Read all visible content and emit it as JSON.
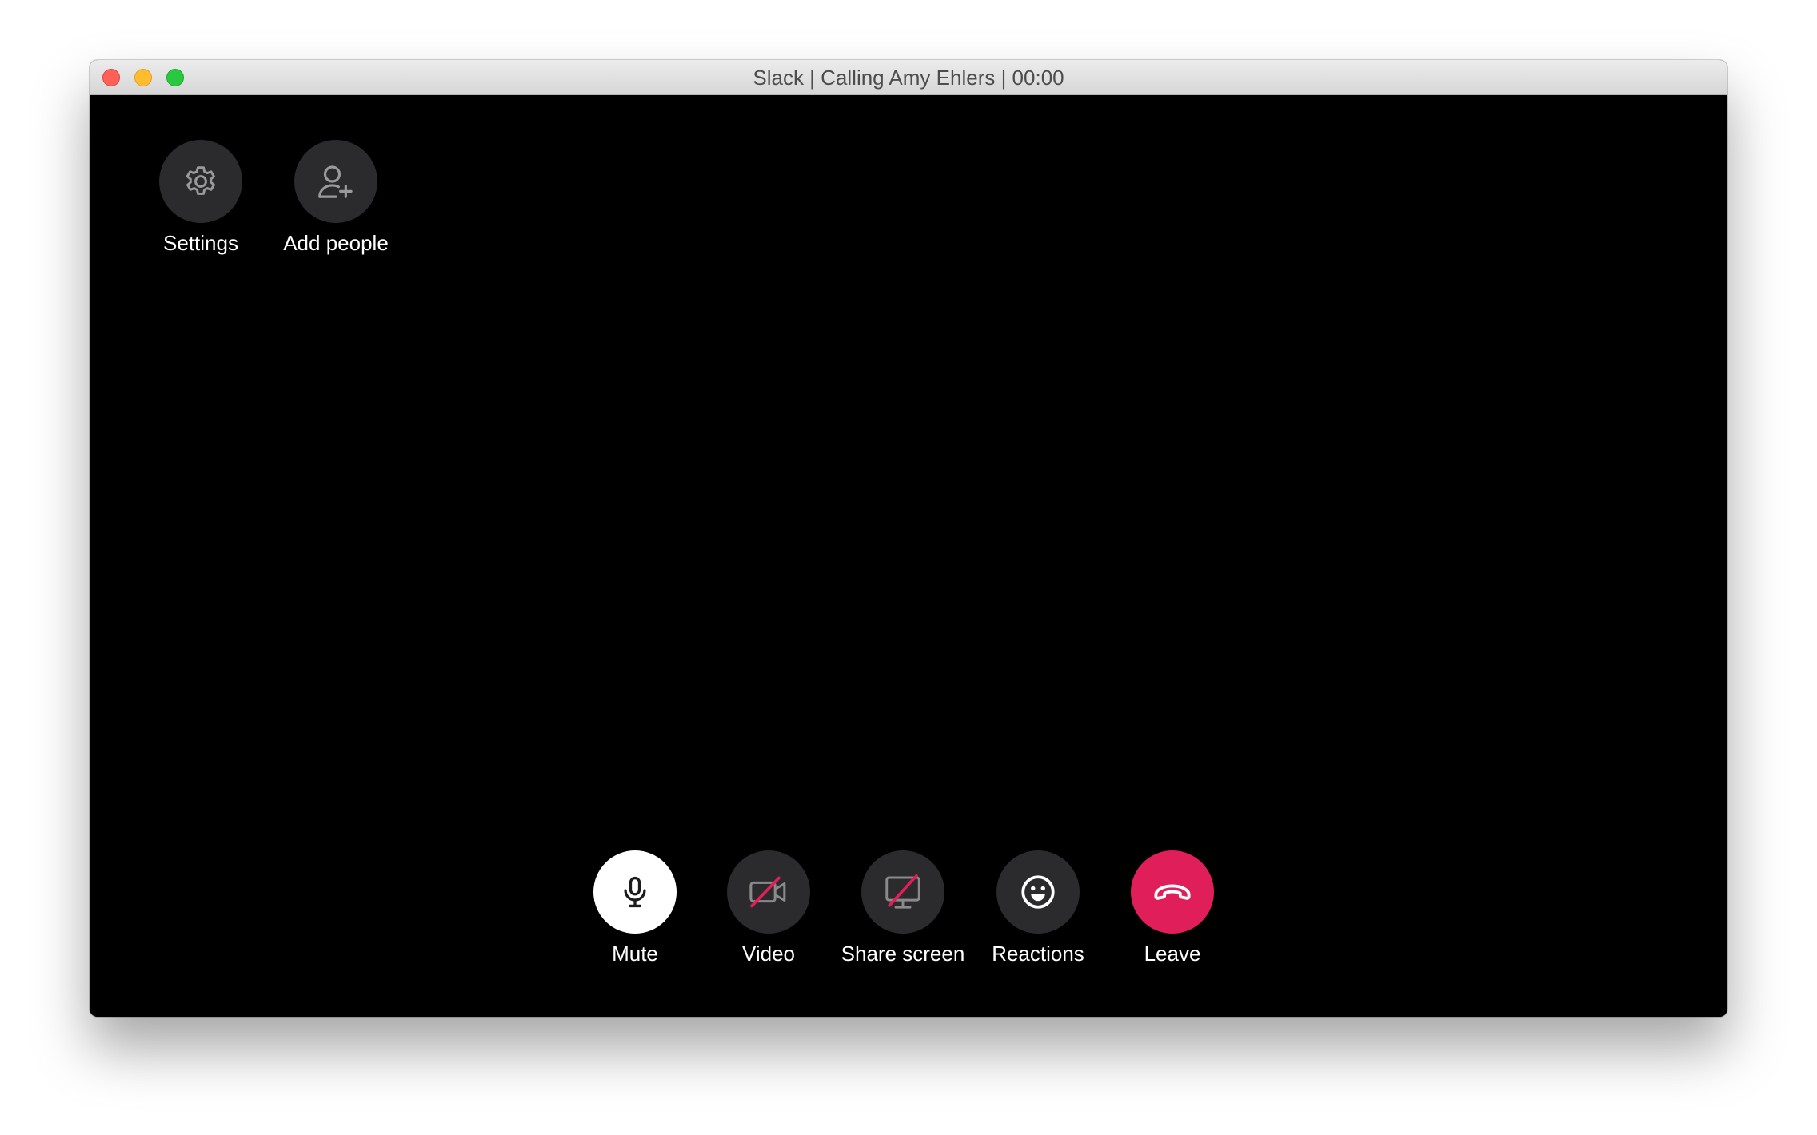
{
  "window": {
    "title": "Slack | Calling Amy Ehlers | 00:00"
  },
  "top_controls": {
    "settings": {
      "label": "Settings",
      "icon": "gear-icon"
    },
    "add_people": {
      "label": "Add people",
      "icon": "add-person-icon"
    }
  },
  "bottom_controls": {
    "mute": {
      "label": "Mute",
      "icon": "microphone-icon"
    },
    "video": {
      "label": "Video",
      "icon": "video-off-icon"
    },
    "share_screen": {
      "label": "Share screen",
      "icon": "screen-share-off-icon"
    },
    "reactions": {
      "label": "Reactions",
      "icon": "smiley-icon"
    },
    "leave": {
      "label": "Leave",
      "icon": "hang-up-icon"
    }
  },
  "colors": {
    "background": "#000000",
    "button": "#2b2b2e",
    "mute_button": "#ffffff",
    "leave_button": "#e01e5a",
    "disabled_slash": "#e01e5a"
  }
}
